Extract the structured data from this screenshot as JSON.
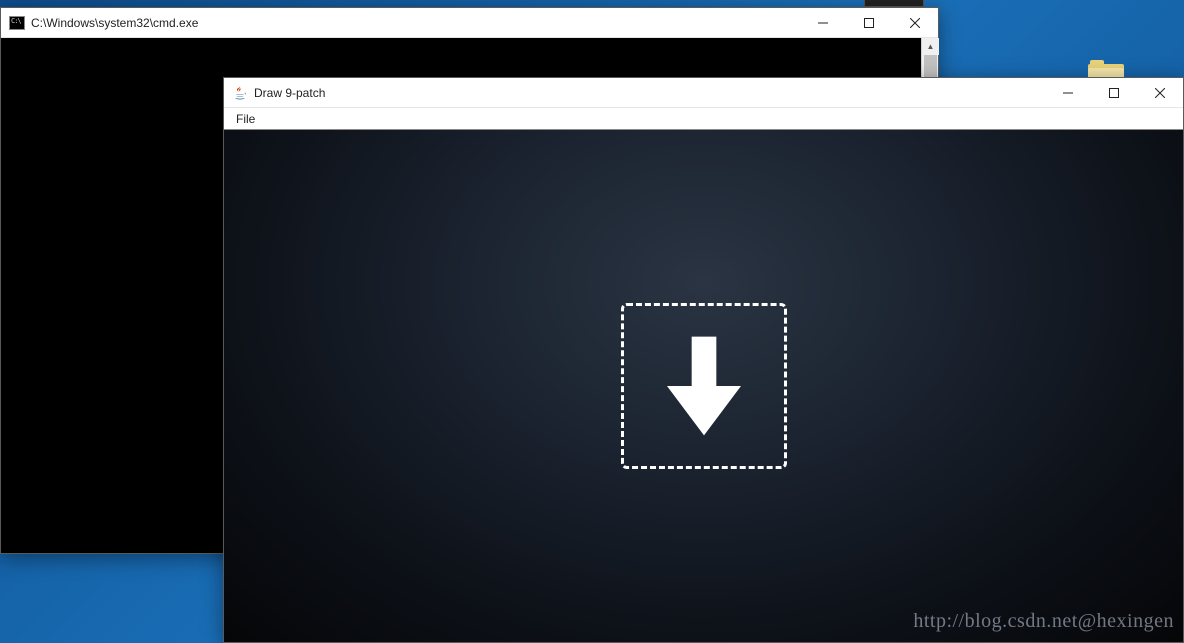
{
  "desktop": {
    "folder_name": "folder-icon"
  },
  "cmd": {
    "title": "C:\\Windows\\system32\\cmd.exe",
    "icon_glyph": "C:\\"
  },
  "draw": {
    "title": "Draw 9-patch",
    "menu": {
      "file": "File"
    }
  },
  "watermark": "http://blog.csdn.net@hexingen"
}
